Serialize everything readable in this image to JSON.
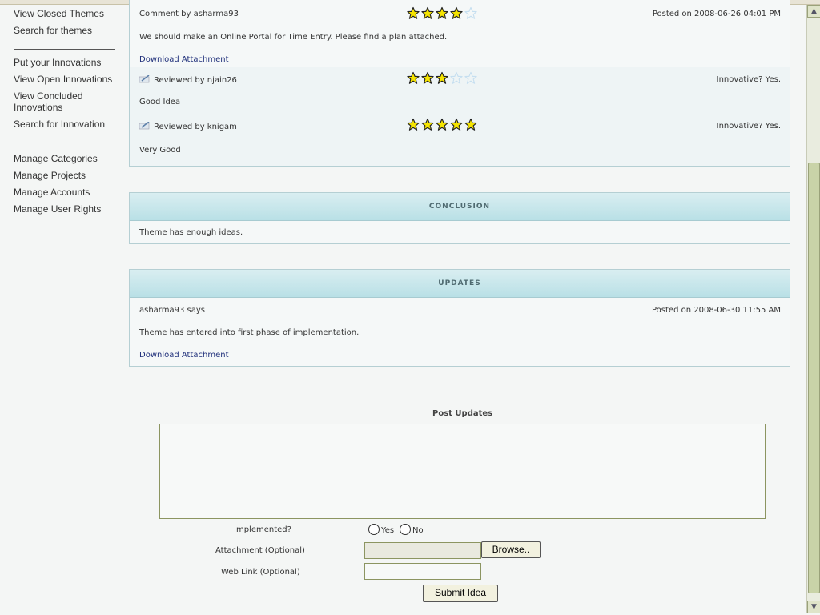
{
  "sidebar": {
    "groups": [
      [
        "View Closed Themes",
        "Search for themes"
      ],
      [
        "Put your Innovations",
        "View Open Innovations",
        "View Concluded Innovations",
        "Search for Innovation"
      ],
      [
        "Manage Categories",
        "Manage Projects",
        "Manage Accounts",
        "Manage User Rights"
      ]
    ]
  },
  "comment": {
    "author_label": "Comment by asharma93",
    "stars": 4,
    "posted": "Posted on 2008-06-26 04:01 PM",
    "body": "We should make an Online Portal for Time Entry. Please find a plan attached.",
    "attachment": "Download Attachment"
  },
  "reviews": [
    {
      "label": "Reviewed by njain26",
      "stars": 3,
      "innovative": "Innovative? Yes.",
      "body": "Good Idea"
    },
    {
      "label": "Reviewed by knigam",
      "stars": 5,
      "innovative": "Innovative? Yes.",
      "body": "Very Good"
    }
  ],
  "conclusion": {
    "title": "CONCLUSION",
    "text": "Theme has enough ideas."
  },
  "updates": {
    "title": "UPDATES",
    "author": "asharma93 says",
    "posted": "Posted on 2008-06-30 11:55 AM",
    "body": "Theme has entered into first phase of implementation.",
    "attachment": "Download Attachment"
  },
  "form": {
    "title": "Post Updates",
    "implemented_label": "Implemented?",
    "yes": "Yes",
    "no": "No",
    "attachment_label": "Attachment (Optional)",
    "browse": "Browse..",
    "weblink_label": "Web Link (Optional)",
    "submit": "Submit Idea"
  },
  "colors": {
    "star_fill": "#f5e400",
    "star_empty": "#c6dff0",
    "link": "#1f2f7a"
  }
}
